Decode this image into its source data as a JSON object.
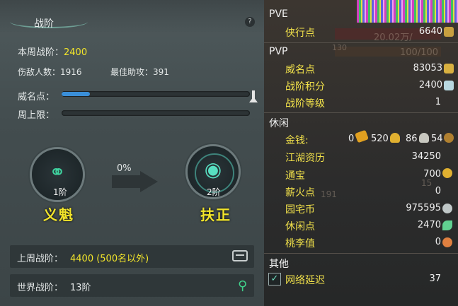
{
  "left_panel": {
    "title": "战阶",
    "help_label": "?",
    "weekly_rank_label": "本周战阶：",
    "weekly_rank_value": "2400",
    "injured_label": "伤敌人数：",
    "injured_value": "1916",
    "best_assist_label": "最佳助攻：",
    "best_assist_value": "391",
    "prestige_label": "威名点：",
    "prestige_progress": 0.15,
    "weekly_cap_label": "周上限：",
    "weekly_cap_progress": 0.0,
    "progress_pct": "0%",
    "current_level": "1阶",
    "current_rank": "义魁",
    "next_level": "2阶",
    "next_rank": "扶正",
    "last_week_label": "上周战阶：",
    "last_week_value": "4400 (500名以外)",
    "world_label": "世界战阶：",
    "world_value": "13阶",
    "icons": [
      "question-icon",
      "chest-icon",
      "location-pin-icon",
      "medal-icon"
    ]
  },
  "right_panel": {
    "sections": {
      "pve": "PVE",
      "pvp": "PVP",
      "leisure": "休闲",
      "other": "其他"
    },
    "background_text": {
      "hp_value": "20.02万/",
      "hp_small": "130",
      "energy": "100/100",
      "badge": "191",
      "num15": "15"
    },
    "pve_rows": [
      {
        "label": "侠行点",
        "value": "6640",
        "icon": "sword-icon",
        "color": "#c8a040"
      }
    ],
    "pvp_rows": [
      {
        "label": "威名点",
        "value": "83053",
        "icon": "token-icon",
        "color": "#d8b040"
      },
      {
        "label": "战阶积分",
        "value": "2400",
        "icon": "crystal-icon",
        "color": "#b8d8e0"
      },
      {
        "label": "战阶等级",
        "value": "1",
        "icon": "",
        "color": ""
      }
    ],
    "money": {
      "label": "金钱:",
      "gold_ingot": "0",
      "gold": "520",
      "silver": "86",
      "copper": "54"
    },
    "leisure_rows": [
      {
        "label": "江湖资历",
        "value": "34250",
        "icon": "",
        "color": ""
      },
      {
        "label": "通宝",
        "value": "700",
        "icon": "coin-icon",
        "color": "#e0b030"
      },
      {
        "label": "薪火点",
        "value": "0",
        "icon": "",
        "color": ""
      },
      {
        "label": "园宅币",
        "value": "975595",
        "icon": "house-coin-icon",
        "color": "#c0c8c8"
      },
      {
        "label": "休闲点",
        "value": "2470",
        "icon": "leaf-icon",
        "color": "#60d090"
      },
      {
        "label": "桃李值",
        "value": "0",
        "icon": "peach-icon",
        "color": "#e08040"
      }
    ],
    "other_rows": [
      {
        "label": "网络延迟",
        "value": "37",
        "checked": true
      }
    ]
  }
}
